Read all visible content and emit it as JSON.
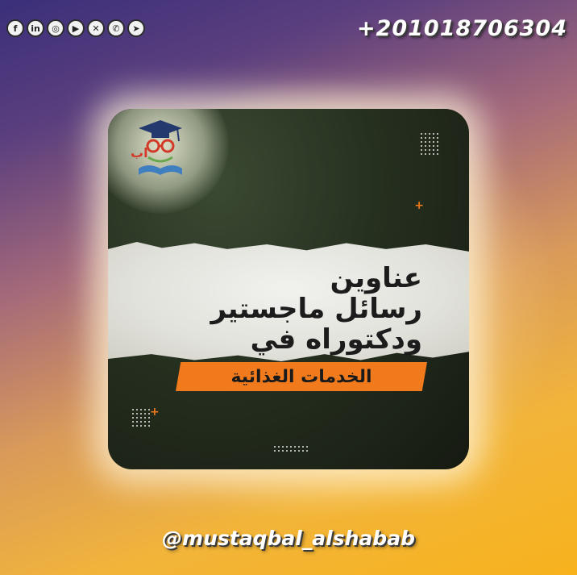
{
  "social": {
    "icons": [
      {
        "name": "facebook-icon",
        "glyph": "f"
      },
      {
        "name": "linkedin-icon",
        "glyph": "in"
      },
      {
        "name": "instagram-icon",
        "glyph": "◎"
      },
      {
        "name": "youtube-icon",
        "glyph": "▶"
      },
      {
        "name": "x-icon",
        "glyph": "✕"
      },
      {
        "name": "whatsapp-icon",
        "glyph": "✆"
      },
      {
        "name": "telegram-icon",
        "glyph": "➤"
      }
    ]
  },
  "header": {
    "phone": "+201018706304"
  },
  "card": {
    "title_line_1": "عناوين",
    "title_line_2": "رسائل ماجستير",
    "title_line_3": "ودكتوراه في",
    "banner_text": "الخدمات الغذائية"
  },
  "footer": {
    "handle": "@mustaqbal_alshabab"
  },
  "colors": {
    "accent": "#f07a1c",
    "card_dark": "#1e2619"
  }
}
